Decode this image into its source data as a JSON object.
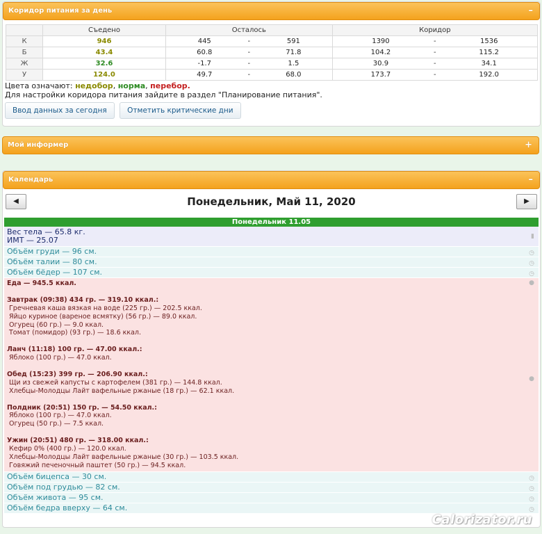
{
  "corridor": {
    "title": "Коридор питания за день",
    "toggle": "–",
    "headers": [
      "Съедено",
      "Осталось",
      "Коридор"
    ],
    "rows": [
      {
        "label": "К",
        "eaten": "946",
        "left_from": "445",
        "left_to": "591",
        "corr_from": "1390",
        "corr_to": "1536",
        "color": "#8a8a00"
      },
      {
        "label": "Б",
        "eaten": "43.4",
        "left_from": "60.8",
        "left_to": "71.8",
        "corr_from": "104.2",
        "corr_to": "115.2",
        "color": "#8a8a00"
      },
      {
        "label": "Ж",
        "eaten": "32.6",
        "left_from": "-1.7",
        "left_to": "1.5",
        "corr_from": "30.9",
        "corr_to": "34.1",
        "color": "#2e8b23"
      },
      {
        "label": "У",
        "eaten": "124.0",
        "left_from": "49.7",
        "left_to": "68.0",
        "corr_from": "173.7",
        "corr_to": "192.0",
        "color": "#8a8a00"
      }
    ],
    "dash": "-",
    "legend_prefix": "Цвета означают:",
    "legend_under": "недобор",
    "legend_norm": "норма",
    "legend_over": "перебор.",
    "sep": ",",
    "hint": "Для настройки коридора питания зайдите в раздел \"Планирование питания\".",
    "btn_input": "Ввод данных за сегодня",
    "btn_critical": "Отметить критические дни"
  },
  "colors": {
    "under": "#8a8a00",
    "norm": "#2e8b23",
    "over": "#c41f1f",
    "accent": "#f4a21d",
    "daybar": "#2f9e2f"
  },
  "informer": {
    "title": "Мой информер",
    "toggle": "+"
  },
  "calendar": {
    "title": "Календарь",
    "toggle": "–",
    "prev": "◀",
    "next": "▶",
    "date": "Понедельник, Май 11, 2020",
    "day_bar": "Понедельник 11.05",
    "weight": "Вес тела — 65.8 кг.",
    "bmi": "ИМТ — 25.07",
    "measures_top": [
      "Объём груди — 96 см.",
      "Объём талии — 80 см.",
      "Объём бёдер — 107 см."
    ],
    "food_lines": [
      {
        "t": "Еда — 945.5 ккал.",
        "h": 1
      },
      {
        "t": "",
        "h": 0
      },
      {
        "t": "Завтрак (09:38) 434 гр. — 319.10 ккал.:",
        "h": 1
      },
      {
        "t": "Гречневая каша вязкая на воде (225 гр.) — 202.5 ккал.",
        "h": 0,
        "i": 1
      },
      {
        "t": "Яйцо куриное (вареное всмятку) (56 гр.) — 89.0 ккал.",
        "h": 0,
        "i": 1
      },
      {
        "t": "Огурец (60 гр.) — 9.0 ккал.",
        "h": 0,
        "i": 1
      },
      {
        "t": "Томат (помидор) (93 гр.) — 18.6 ккал.",
        "h": 0,
        "i": 1
      },
      {
        "t": "",
        "h": 0
      },
      {
        "t": "Ланч (11:18) 100 гр. — 47.00 ккал.:",
        "h": 1
      },
      {
        "t": "Яблоко (100 гр.) — 47.0 ккал.",
        "h": 0,
        "i": 1
      },
      {
        "t": "",
        "h": 0
      },
      {
        "t": "Обед (15:23) 399 гр. — 206.90 ккал.:",
        "h": 1
      },
      {
        "t": "Щи из свежей капусты с картофелем (381 гр.) — 144.8 ккал.",
        "h": 0,
        "i": 1
      },
      {
        "t": "Хлебцы-Молодцы Лайт вафельные ржаные (18 гр.) — 62.1 ккал.",
        "h": 0,
        "i": 1
      },
      {
        "t": "",
        "h": 0
      },
      {
        "t": "Полдник (20:51) 150 гр. — 54.50 ккал.:",
        "h": 1
      },
      {
        "t": "Яблоко (100 гр.) — 47.0 ккал.",
        "h": 0,
        "i": 1
      },
      {
        "t": "Огурец (50 гр.) — 7.5 ккал.",
        "h": 0,
        "i": 1
      },
      {
        "t": "",
        "h": 0
      },
      {
        "t": "Ужин (20:51) 480 гр. — 318.00 ккал.:",
        "h": 1
      },
      {
        "t": "Кефир 0% (400 гр.) — 120.0 ккал.",
        "h": 0,
        "i": 1
      },
      {
        "t": "Хлебцы-Молодцы Лайт вафельные ржаные (30 гр.) — 103.5 ккал.",
        "h": 0,
        "i": 1
      },
      {
        "t": "Говяжий печеночный паштет (50 гр.) — 94.5 ккал.",
        "h": 0,
        "i": 1
      }
    ],
    "measures_bottom": [
      "Объём бицепса — 30 см.",
      "Объём под грудью — 82 см.",
      "Объём живота — 95 см.",
      "Объём бедра вверху — 64 см."
    ]
  },
  "watermark": "Calorizator.ru"
}
